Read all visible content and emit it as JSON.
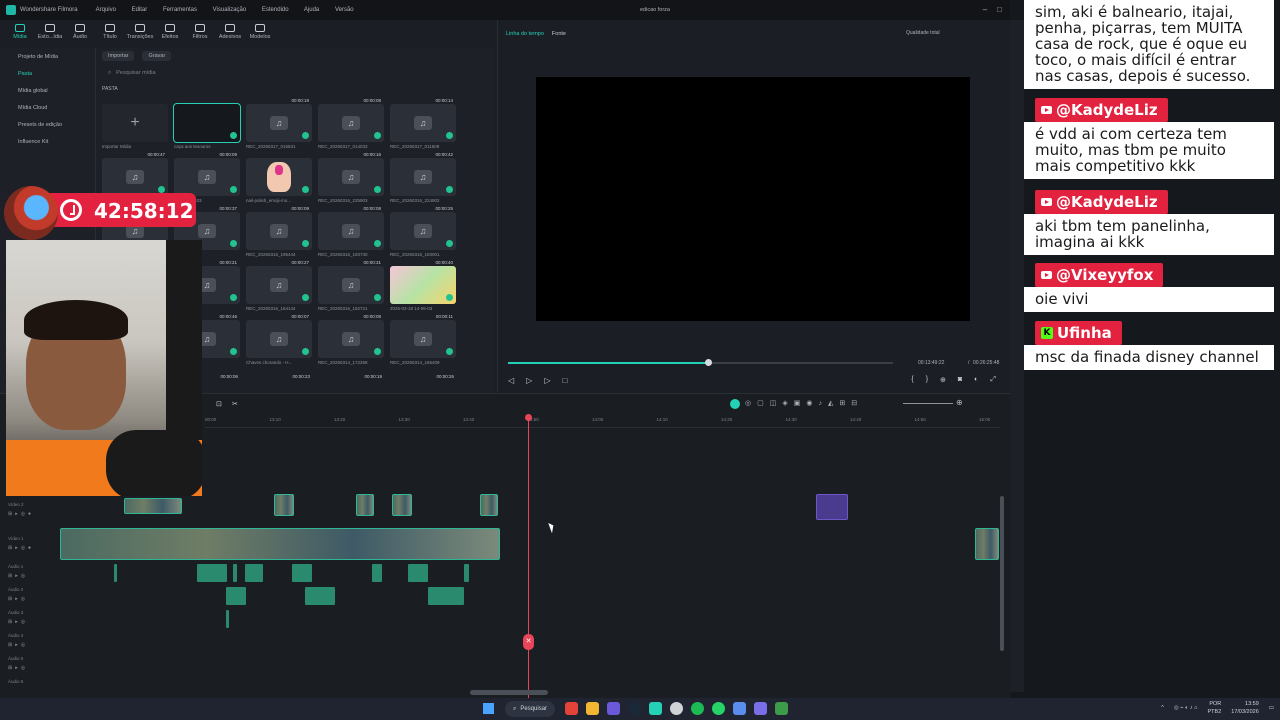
{
  "titlebar": {
    "app": "Wondershare Filmora",
    "menu": [
      "Arquivo",
      "Editar",
      "Ferramentas",
      "Visualização",
      "Estendido",
      "Ajuda",
      "Versão"
    ],
    "doc": "edicao forza"
  },
  "toolbar": [
    "Mídia",
    "Esto...ídia",
    "Áudio",
    "Título",
    "Transições",
    "Efeitos",
    "Filtros",
    "Adesivos",
    "Modelos"
  ],
  "leftnav": [
    "Projeto de Mídia",
    "Pasta",
    "Mídia global",
    "Mídia Cloud",
    "Presets de edição",
    "Influence Kit"
  ],
  "media": {
    "import": "Importar",
    "record": "Gravar",
    "search_placeholder": "Pesquisar mídia",
    "folder": "PASTA",
    "items": [
      {
        "cap": "Importar Mídia",
        "dur": ""
      },
      {
        "cap": "caça aos tesouros",
        "dur": ""
      },
      {
        "cap": "REC_20260317_015631",
        "dur": "00:00:19"
      },
      {
        "cap": "REC_20260317_014033",
        "dur": "00:00:08"
      },
      {
        "cap": "REC_20260317_011508",
        "dur": "00:00:14"
      },
      {
        "cap": "",
        "dur": "00:00:47"
      },
      {
        "cap": "0316_234933",
        "dur": "00:00:09"
      },
      {
        "cap": "nail-polish_emoji-mo...",
        "dur": ""
      },
      {
        "cap": "REC_20260316_225903",
        "dur": "00:00:16"
      },
      {
        "cap": "REC_20260316_224902",
        "dur": "00:00:42"
      },
      {
        "cap": "",
        "dur": ""
      },
      {
        "cap": "316_203618",
        "dur": "00:00:37"
      },
      {
        "cap": "REC_20260316_195444",
        "dur": "00:00:09"
      },
      {
        "cap": "REC_20260316_193730",
        "dur": "00:00:08"
      },
      {
        "cap": "REC_20260316_183001",
        "dur": "00:00:25"
      },
      {
        "cap": "",
        "dur": ""
      },
      {
        "cap": "316_172224",
        "dur": "00:00:21"
      },
      {
        "cap": "REC_20260316_164144",
        "dur": "00:00:27"
      },
      {
        "cap": "REC_20260316_152721",
        "dur": "00:00:31"
      },
      {
        "cap": "2026-03-18 14-06-03",
        "dur": "00:00:40"
      },
      {
        "cap": "",
        "dur": ""
      },
      {
        "cap": "316_125911",
        "dur": "00:00:46"
      },
      {
        "cap": "Chaves chorando - H...",
        "dur": "00:00:07"
      },
      {
        "cap": "REC_20260314_172258",
        "dur": "00:00:08"
      },
      {
        "cap": "REC_20260314_165409",
        "dur": "00:00:11"
      }
    ],
    "bottom_durs": [
      "00:00:06",
      "00:00:23",
      "00:00:19",
      "00:00:26"
    ]
  },
  "preview": {
    "tab_timeline": "Linha do tempo",
    "tab_source": "Fonte",
    "quality": "Qualidade total",
    "current_time": "00:13:49:22",
    "total_time": "00:26:25:48",
    "progress": 0.52
  },
  "timeline": {
    "ruler": [
      "00:00",
      "13:10",
      "13:20",
      "13:30",
      "13:40",
      "13:50",
      "14:00",
      "14:10",
      "14:20",
      "14:30",
      "14:40",
      "14:50",
      "15:00"
    ],
    "tracks": [
      "Vídeo 2",
      "Vídeo 1",
      "Áudio 1",
      "Áudio 2",
      "Áudio 3",
      "Áudio 4",
      "Áudio 5",
      "Áudio 6"
    ]
  },
  "overlay": {
    "timer": "42:58:12"
  },
  "chat": [
    {
      "user": "",
      "platform": "none",
      "text": "sim, aki é balneario, itajai, penha, piçarras, tem MUITA casa de rock, que é oque eu toco, o mais difícil é entrar nas casas, depois é sucesso."
    },
    {
      "user": "@KadydeLiz",
      "platform": "youtube",
      "text": "é vdd ai com certeza tem muito, mas tbm pe muito mais competitivo kkk"
    },
    {
      "user": "@KadydeLiz",
      "platform": "youtube",
      "text": "aki tbm tem panelinha, imagina ai kkk"
    },
    {
      "user": "@Vixeyyfox",
      "platform": "youtube",
      "text": "oie vivi"
    },
    {
      "user": "Ufinha",
      "platform": "kick",
      "text": "msc da finada disney channel"
    }
  ],
  "taskbar": {
    "search": "Pesquisar",
    "lang": "POR",
    "layout": "PTB2",
    "time": "13:59",
    "date": "17/03/2026"
  }
}
